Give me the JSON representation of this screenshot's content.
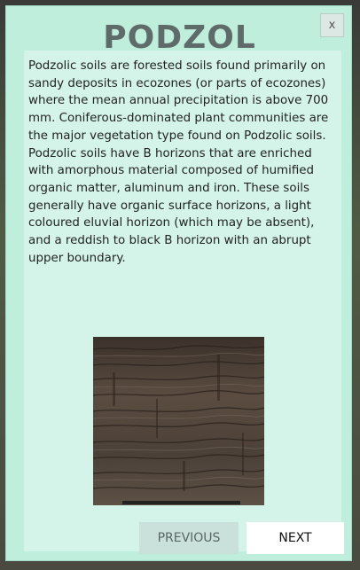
{
  "modal": {
    "title": "PODZOL",
    "close_label": "x",
    "description": "Podzolic soils are forested soils found primarily on sandy deposits in ecozones (or parts of ecozones) where the mean annual precipitation is above 700 mm. Coniferous-dominated plant communities are the major vegetation type found on Podzolic soils. Podzolic soils have B horizons that are enriched with amorphous material composed of humified organic matter, aluminum and iron. These soils generally have organic surface horizons, a light coloured eluvial horizon (which may be absent), and a reddish to black B horizon with an abrupt upper boundary.",
    "image_alt": "soil-profile-photo"
  },
  "nav": {
    "previous_label": "PREVIOUS",
    "next_label": "NEXT"
  },
  "colors": {
    "modal_background": "#bfeedd",
    "panel_background": "#d4f4e9",
    "title_color": "#5e6b68",
    "previous_button": "#c9e1da",
    "next_button": "#ffffff"
  }
}
